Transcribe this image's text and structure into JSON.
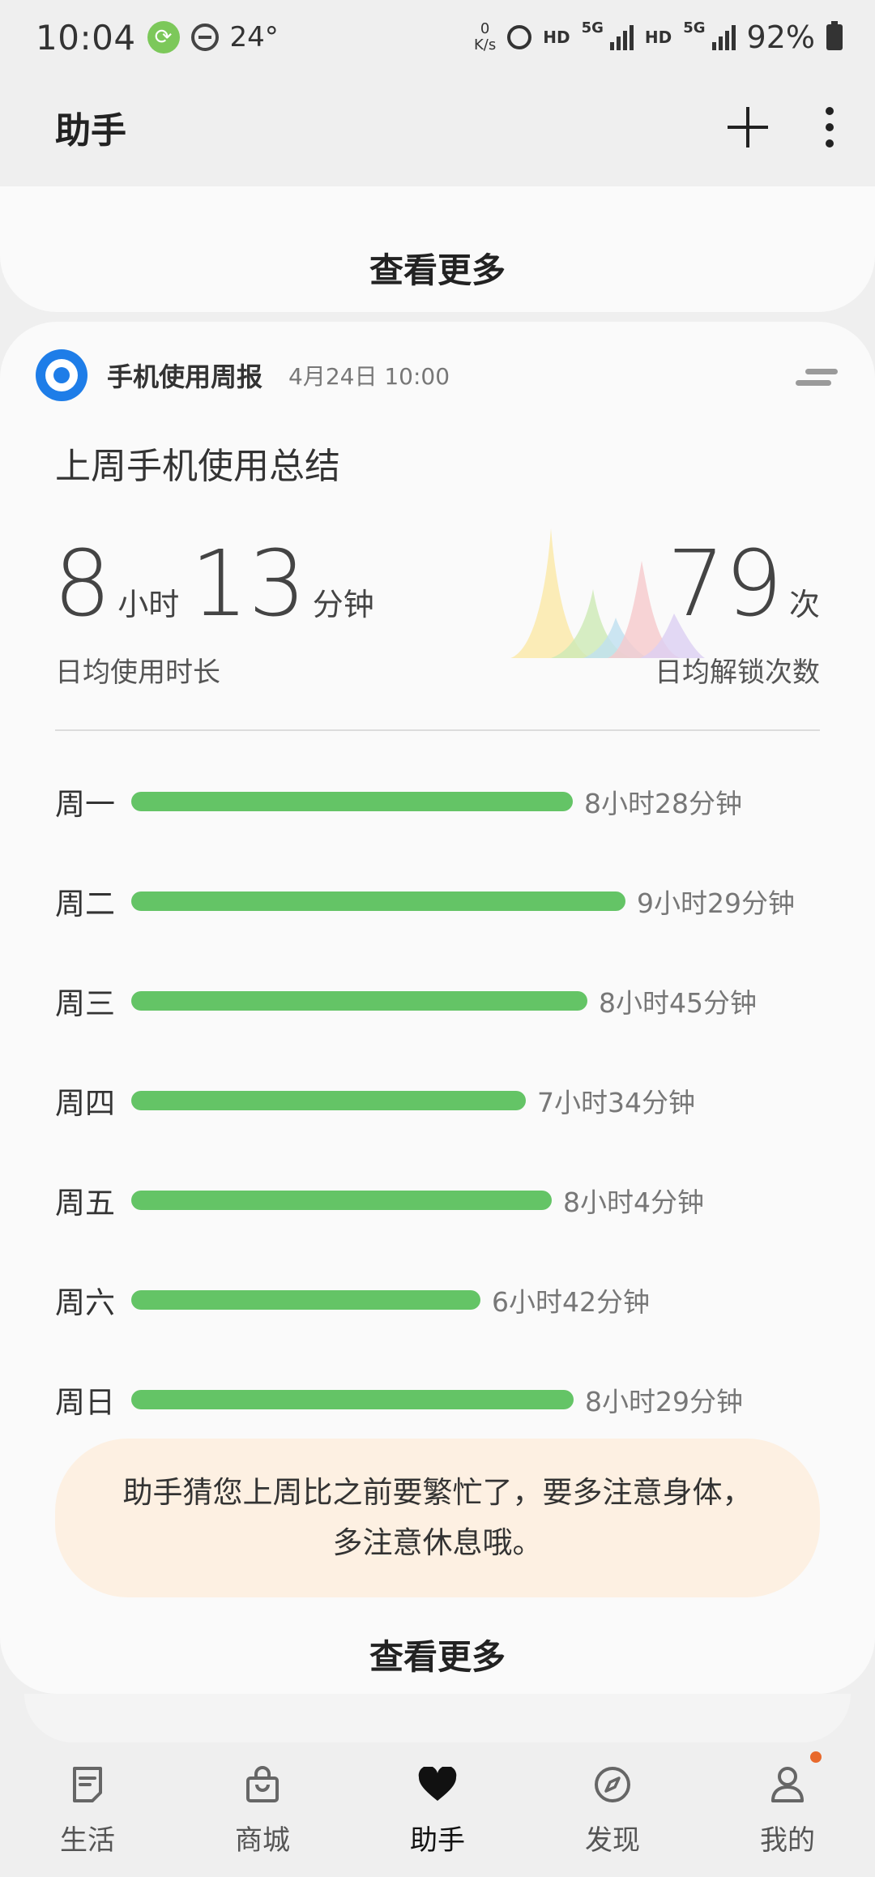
{
  "status_bar": {
    "time": "10:04",
    "temperature": "24°",
    "net_speed_value": "0",
    "net_speed_unit": "K/s",
    "hd1": "HD",
    "net1": "5G",
    "hd2": "HD",
    "net2": "5G",
    "battery": "92%"
  },
  "header": {
    "title": "助手"
  },
  "top_card": {
    "see_more": "查看更多"
  },
  "report": {
    "name": "手机使用周报",
    "date": "4月24日 10:00",
    "summary_title": "上周手机使用总结",
    "hours": "8",
    "hours_unit": "小时",
    "minutes": "13",
    "minutes_unit": "分钟",
    "usage_label": "日均使用时长",
    "unlocks": "79",
    "unlocks_unit": "次",
    "unlocks_label": "日均解锁次数",
    "days": [
      {
        "label": "周一",
        "value": "8小时28分钟",
        "minutes": 508
      },
      {
        "label": "周二",
        "value": "9小时29分钟",
        "minutes": 569
      },
      {
        "label": "周三",
        "value": "8小时45分钟",
        "minutes": 525
      },
      {
        "label": "周四",
        "value": "7小时34分钟",
        "minutes": 454
      },
      {
        "label": "周五",
        "value": "8小时4分钟",
        "minutes": 484
      },
      {
        "label": "周六",
        "value": "6小时42分钟",
        "minutes": 402
      },
      {
        "label": "周日",
        "value": "8小时29分钟",
        "minutes": 509
      }
    ],
    "tip": "助手猜您上周比之前要繁忙了，要多注意身体，\n多注意休息哦。",
    "see_more": "查看更多",
    "bar_color": "#64c466"
  },
  "bottom_nav": [
    {
      "label": "生活",
      "icon": "life-icon"
    },
    {
      "label": "商城",
      "icon": "shopping-bag-icon"
    },
    {
      "label": "助手",
      "icon": "heart-icon"
    },
    {
      "label": "发现",
      "icon": "compass-icon"
    },
    {
      "label": "我的",
      "icon": "person-icon"
    }
  ],
  "active_nav": "助手"
}
